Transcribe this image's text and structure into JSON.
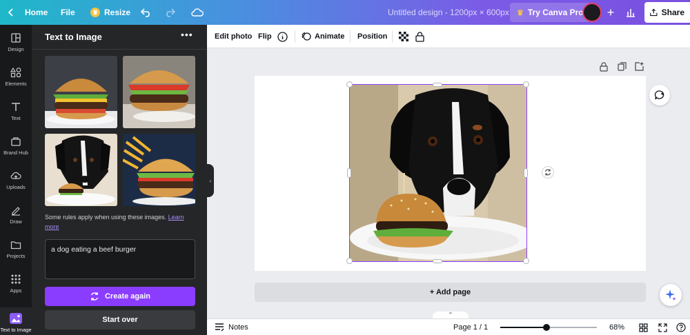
{
  "topbar": {
    "home_label": "Home",
    "file_label": "File",
    "resize_label": "Resize",
    "doc_title": "Untitled design - 1200px × 600px",
    "pro_label": "Try Canva Pro",
    "share_label": "Share",
    "crown_glyph": "♛"
  },
  "rail": {
    "items": [
      {
        "label": "Design",
        "icon": "design-icon"
      },
      {
        "label": "Elements",
        "icon": "elements-icon"
      },
      {
        "label": "Text",
        "icon": "text-icon"
      },
      {
        "label": "Brand Hub",
        "icon": "brand-hub-icon"
      },
      {
        "label": "Uploads",
        "icon": "uploads-icon"
      },
      {
        "label": "Draw",
        "icon": "draw-icon"
      },
      {
        "label": "Projects",
        "icon": "projects-icon"
      },
      {
        "label": "Apps",
        "icon": "apps-icon"
      },
      {
        "label": "Text to Image",
        "icon": "text-to-image-icon"
      }
    ]
  },
  "panel": {
    "title": "Text to Image",
    "more_glyph": "•••",
    "rules_text": "Some rules apply when using these images.",
    "learn_more": "Learn more",
    "prompt_value": "a dog eating a beef burger",
    "create_again": "Create again",
    "start_over": "Start over"
  },
  "context_toolbar": {
    "edit_photo": "Edit photo",
    "flip": "Flip",
    "animate": "Animate",
    "position": "Position"
  },
  "canvas": {
    "add_page": "+ Add page"
  },
  "footer": {
    "notes": "Notes",
    "page_indicator": "Page 1 / 1",
    "zoom_level": "68%",
    "zoom_fraction": 0.48
  },
  "colors": {
    "accent": "#8b3dff",
    "panel_bg": "#252627",
    "rail_bg": "#18191b"
  }
}
